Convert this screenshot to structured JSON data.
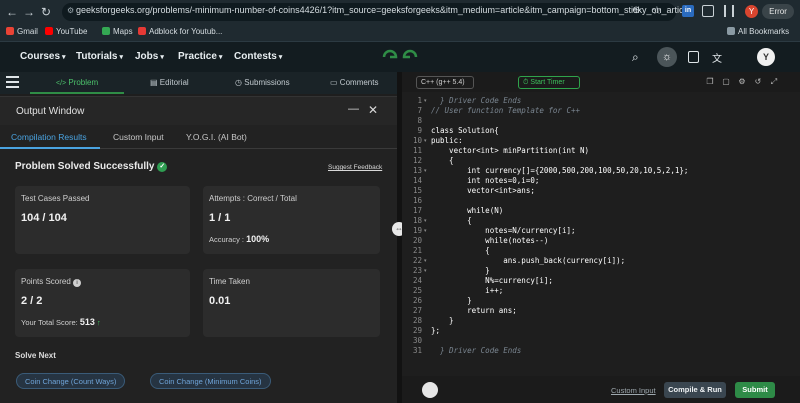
{
  "browser": {
    "url": "geeksforgeeks.org/problems/-minimum-number-of-coins4426/1?itm_source=geeksforgeeks&itm_medium=article&itm_campaign=bottom_sticky_on_article",
    "profile_initial": "Y",
    "error_label": "Error",
    "bookmarks": [
      "Gmail",
      "YouTube",
      "Maps",
      "Adblock for Youtub..."
    ],
    "all_bookmarks": "All Bookmarks"
  },
  "header": {
    "menus": [
      "Courses",
      "Tutorials",
      "Jobs",
      "Practice",
      "Contests"
    ],
    "avatar_initial": "Y"
  },
  "problem_tabs": [
    "Problem",
    "Editorial",
    "Submissions",
    "Comments"
  ],
  "output": {
    "title": "Output Window",
    "tabs": [
      "Compilation Results",
      "Custom Input",
      "Y.O.G.I. (AI Bot)"
    ],
    "status": "Problem Solved Successfully",
    "feedback": "Suggest Feedback",
    "test_cases_label": "Test Cases Passed",
    "test_cases_value": "104 / 104",
    "attempts_label": "Attempts : Correct / Total",
    "attempts_value": "1 / 1",
    "accuracy_label": "Accuracy :",
    "accuracy_value": "100%",
    "points_label": "Points Scored",
    "points_value": "2 / 2",
    "total_score_label": "Your Total Score:",
    "total_score_value": "513",
    "time_label": "Time Taken",
    "time_value": "0.01",
    "solve_next_label": "Solve Next",
    "solve_next": [
      "Coin Change (Count Ways)",
      "Coin Change (Minimum Coins)"
    ]
  },
  "editor": {
    "language": "C++ (g++ 5.4)",
    "timer_label": "Start Timer",
    "line_numbers": [
      "1",
      "7",
      "8",
      "9",
      "10",
      "11",
      "12",
      "13",
      "14",
      "15",
      "16",
      "17",
      "18",
      "19",
      "20",
      "21",
      "22",
      "23",
      "24",
      "25",
      "26",
      "27",
      "28",
      "29",
      "30",
      "31"
    ],
    "lines": [
      "  } Driver Code Ends",
      "// User function Template for C++",
      "",
      "class Solution{",
      "public:",
      "    vector<int> minPartition(int N)",
      "    {",
      "        int currency[]={2000,500,200,100,50,20,10,5,2,1};",
      "        int notes=0,i=0;",
      "        vector<int>ans;",
      "",
      "        while(N)",
      "        {",
      "            notes=N/currency[i];",
      "            while(notes--)",
      "            {",
      "                ans.push_back(currency[i]);",
      "            }",
      "            N%=currency[i];",
      "            i++;",
      "        }",
      "        return ans;",
      "    }",
      "};",
      "",
      "  } Driver Code Ends"
    ],
    "custom_input": "Custom Input",
    "compile_run": "Compile & Run",
    "submit": "Submit"
  },
  "colors": {
    "accent_green": "#2e8b47",
    "tab_active": "#4aa3e0"
  }
}
